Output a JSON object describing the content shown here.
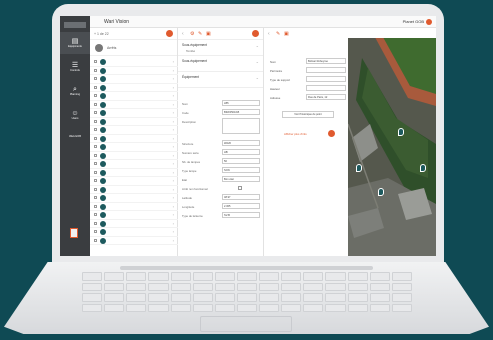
{
  "app": {
    "title": "Wari Vision",
    "logo_label": "",
    "user_name": "Planet GOB"
  },
  "sidebar": {
    "items": [
      {
        "label": "Equipments",
        "icon": "clipboard-icon"
      },
      {
        "label": "Controls",
        "icon": "list-icon"
      },
      {
        "label": "Planning",
        "icon": "search-icon"
      },
      {
        "label": "Users",
        "icon": "user-icon"
      }
    ],
    "extra_label": "Wari-GOB"
  },
  "list_panel": {
    "breadcrumb": "+ 1 de 22",
    "group_label": "Arrêts",
    "rows": [
      "",
      "",
      "",
      "",
      "",
      "",
      "",
      "",
      "",
      "",
      "",
      "",
      "",
      "",
      "",
      "",
      "",
      "",
      "",
      "",
      "",
      ""
    ]
  },
  "form_panel": {
    "sections": [
      {
        "title": "Sous-équipement",
        "sub": "Tombé"
      },
      {
        "title": "Sous-équipement",
        "sub": ""
      },
      {
        "title": "Équipement",
        "sub": ""
      }
    ],
    "fields": [
      {
        "label": "Nom",
        "value": "LB5"
      },
      {
        "label": "Code",
        "value": "B3W4501/1B"
      },
      {
        "label": "Description",
        "value": "",
        "type": "textarea"
      },
      {
        "label": "Structure",
        "value": "WA20"
      },
      {
        "label": "Numéro série",
        "value": "HB"
      },
      {
        "label": "Nb. de lampes",
        "value": "50"
      },
      {
        "label": "Type lampe",
        "value": "SON"
      },
      {
        "label": "Etat",
        "value": "Bon état"
      },
      {
        "label": "Arrêt non fonctionnel",
        "value": "",
        "type": "check"
      },
      {
        "label": "Latitude",
        "value": "48.97"
      },
      {
        "label": "Longitude",
        "value": "2.305"
      },
      {
        "label": "Type de lanterne",
        "value": "SV-B"
      }
    ]
  },
  "detail_panel": {
    "fields": [
      {
        "label": "Nom",
        "value": "Bolivar Robeyroe"
      },
      {
        "label": "Périmètre",
        "value": ""
      },
      {
        "label": "Type de support",
        "value": ""
      },
      {
        "label": "Hauteur",
        "value": ""
      },
      {
        "label": "Adresse",
        "value": "Rue de Paris, 12"
      }
    ],
    "action_label": "Voir l'historique du point",
    "link_label": "Afficher plus d'info"
  },
  "colors": {
    "accent": "#e05a2e",
    "sidebar": "#3a3d40",
    "marker": "#1d5a5e",
    "background": "#0f4a54"
  }
}
